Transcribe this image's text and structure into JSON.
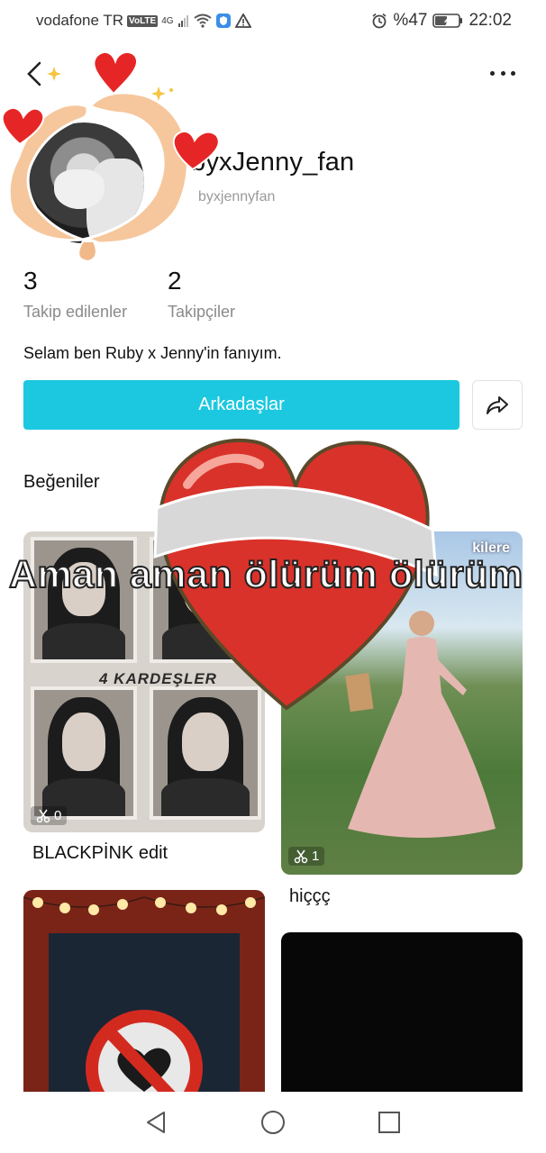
{
  "status_bar": {
    "carrier": "vodafone TR",
    "volte": "VoLTE",
    "network": "4G",
    "battery_percent": "%47",
    "time": "22:02"
  },
  "profile": {
    "username": "byxJenny_fan",
    "handle": "byxjennyfan",
    "stats": [
      {
        "value": "3",
        "label": "Takip edilenler"
      },
      {
        "value": "2",
        "label": "Takipçiler"
      }
    ],
    "bio": "Selam ben Ruby x Jenny'in fanıyım.",
    "friends_button": "Arkadaşlar"
  },
  "likes": {
    "section_title": "Beğeniler",
    "items": [
      {
        "title": "BLACKPİNK edit",
        "count": "0",
        "badge_text": "4 KARDEŞLER"
      },
      {
        "title": "hiççç",
        "count": "1",
        "badge_text": "kilere"
      },
      {
        "title": "",
        "count": ""
      },
      {
        "title": "",
        "count": ""
      }
    ]
  },
  "overlay": {
    "text": "Aman aman ölürüm ölürüm"
  },
  "colors": {
    "accent": "#1cc8e0",
    "heart": "#e0302a"
  },
  "icons": [
    "back-arrow-icon",
    "more-icon",
    "share-icon",
    "scissors-icon",
    "nav-back-icon",
    "nav-home-icon",
    "nav-recents-icon"
  ]
}
